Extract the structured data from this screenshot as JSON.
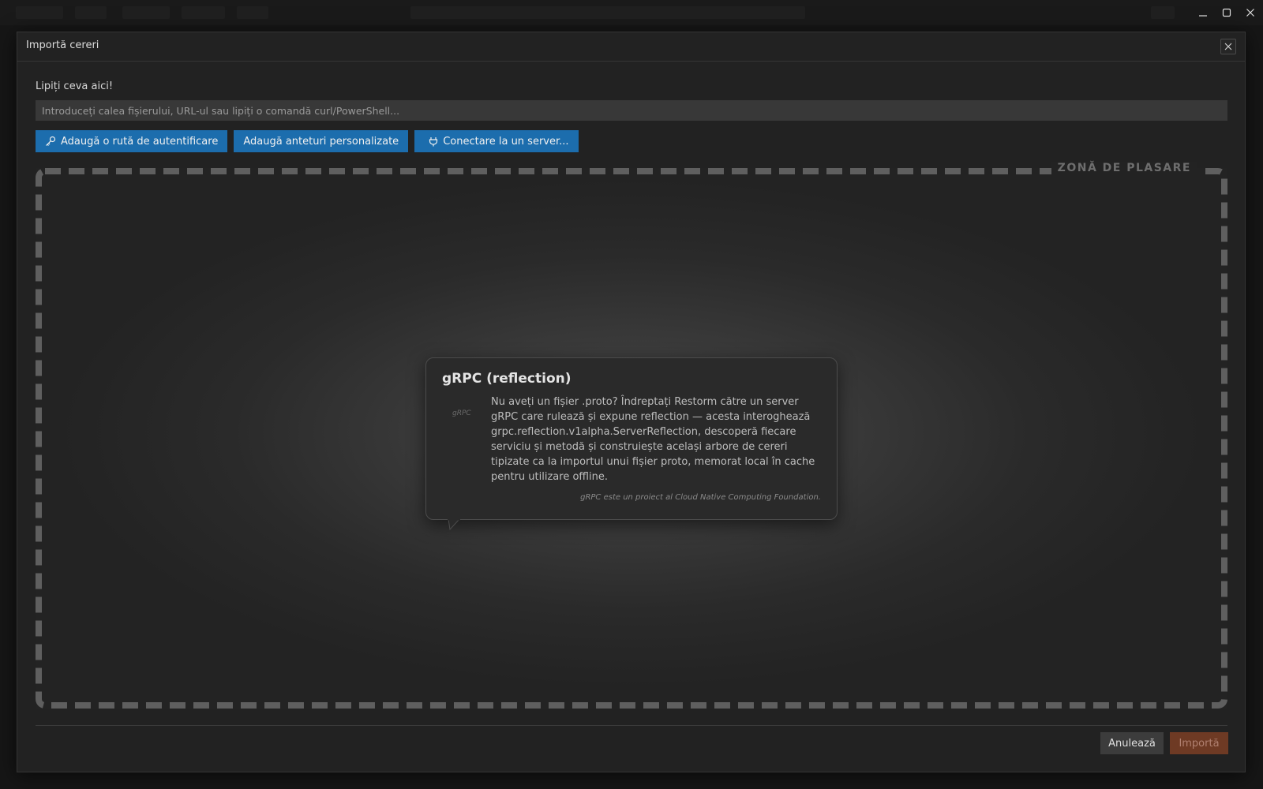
{
  "window": {
    "controls": [
      "minimize",
      "maximize",
      "close"
    ]
  },
  "dialog": {
    "title": "Importă cereri",
    "close_icon": "close-icon"
  },
  "paste": {
    "label": "Lipiți ceva aici!",
    "value": "",
    "placeholder": "Introduceți calea fișierului, URL-ul sau lipiți o comandă curl/PowerShell..."
  },
  "actions": {
    "auth_label": "Adaugă o rută de autentificare",
    "auth_icon": "key-icon",
    "headers_label": "Adaugă anteturi personalizate",
    "connect_label": "Conectare la un server...",
    "connect_icon": "plug-icon"
  },
  "drop_zone": {
    "label": "ZONĂ DE PLASARE"
  },
  "tooltip": {
    "title": "gRPC (reflection)",
    "logo_text": "gRPC",
    "body": "Nu aveți un fișier .proto? Îndreptați Restorm către un server gRPC care rulează și expune reflection — acesta interoghează grpc.reflection.v1alpha.ServerReflection, descoperă fiecare serviciu și metodă și construiește același arbore de cereri tipizate ca la importul unui fișier proto, memorat local în cache pentru utilizare offline.",
    "footnote": "gRPC este un proiect al Cloud Native Computing Foundation."
  },
  "footer": {
    "cancel_label": "Anulează",
    "import_label": "Importă"
  },
  "colors": {
    "accent_blue": "#1c6dad",
    "import_disabled": "#6e3a24",
    "background": "#222222"
  }
}
